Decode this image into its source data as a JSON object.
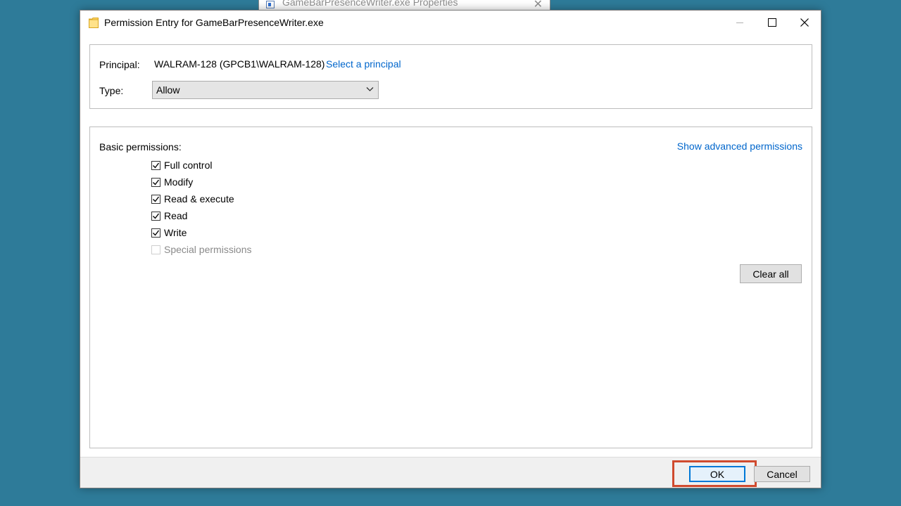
{
  "background_window": {
    "title": "GameBarPresenceWriter.exe Properties",
    "close_glyph": "✕"
  },
  "dialog": {
    "title": "Permission Entry for GameBarPresenceWriter.exe",
    "icon": "folder-icon",
    "controls": {
      "close_glyph": "✕"
    }
  },
  "principal": {
    "label": "Principal:",
    "value": "WALRAM-128 (GPCB1\\WALRAM-128)",
    "select_link": "Select a principal"
  },
  "type": {
    "label": "Type:",
    "selected": "Allow"
  },
  "permissions": {
    "heading": "Basic permissions:",
    "advanced_link": "Show advanced permissions",
    "items": [
      {
        "label": "Full control",
        "checked": true,
        "enabled": true
      },
      {
        "label": "Modify",
        "checked": true,
        "enabled": true
      },
      {
        "label": "Read & execute",
        "checked": true,
        "enabled": true
      },
      {
        "label": "Read",
        "checked": true,
        "enabled": true
      },
      {
        "label": "Write",
        "checked": true,
        "enabled": true
      },
      {
        "label": "Special permissions",
        "checked": false,
        "enabled": false
      }
    ],
    "clear_all": "Clear all"
  },
  "footer": {
    "ok": "OK",
    "cancel": "Cancel"
  },
  "colors": {
    "desktop": "#2e7b99",
    "link": "#0066cc",
    "highlight": "#d04a2e",
    "default_button_border": "#0078d7"
  }
}
